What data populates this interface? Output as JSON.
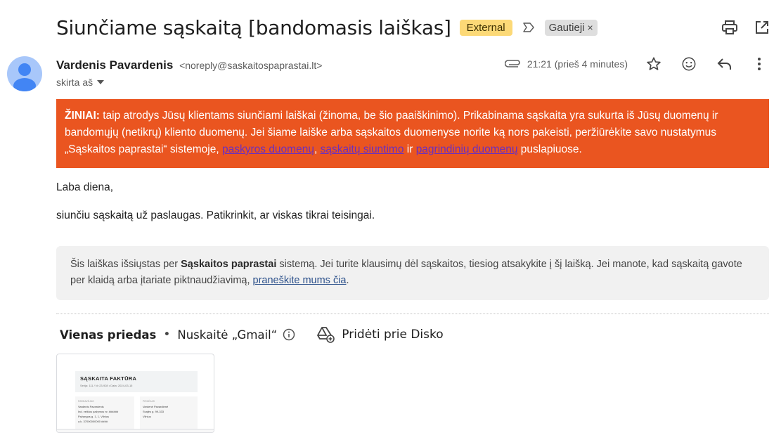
{
  "subject": "Siunčiame sąskaitą [bandomasis laiškas]",
  "badges": {
    "external": "External",
    "label": "Gautieji",
    "label_remove": "×"
  },
  "sender": {
    "name": "Vardenis Pavardenis",
    "email": "<noreply@saskaitospaprastai.lt>",
    "to": "skirta aš",
    "time": "21:21 (prieš 4 minutes)"
  },
  "notice": {
    "lead": "ŽINIAI:",
    "text1": " taip atrodys Jūsų klientams siunčiami laiškai (žinoma, be šio paaiškinimo). Prikabinama sąskaita yra sukurta iš Jūsų duomenų ir bandomųjų (netikrų) kliento duomenų. Jei šiame laiške arba sąskaitos duomenyse norite ką nors pakeisti, peržiūrėkite savo nustatymus „Sąskaitos paprastai“ sistemoje, ",
    "link1": "paskyros duomenų",
    "sep1": ", ",
    "link2": "sąskaitų siuntimo",
    "sep2": " ir ",
    "link3": "pagrindinių duomenų",
    "text2": " puslapiuose."
  },
  "body": {
    "greeting": "Laba diena,",
    "line": "siunčiu sąskaitą už paslaugas. Patikrinkit, ar viskas tikrai teisingai."
  },
  "footer": {
    "text1": "Šis laiškas išsiųstas per ",
    "brand": "Sąskaitos paprastai",
    "text2": " sistemą. Jei turite klausimų dėl sąskaitos, tiesiog atsakykite į šį laišką. Jei manote, kad sąskaitą gavote per klaidą arba įtariate piktnaudžiavimą, ",
    "link": "praneškite mums čia",
    "text3": "."
  },
  "attachments": {
    "count": "Vienas priedas",
    "dot": "•",
    "scanned": "Nuskaitė „Gmail“",
    "drive": "Pridėti prie Disko"
  },
  "thumbnail": {
    "title": "SĄSKAITA FAKTŪRA",
    "sub": "Serija: 111 / Nr 23-928  •  Data: 2024-03-15",
    "seller_cap": "Pardavėjas",
    "seller": [
      "Vardenis Pavardenis",
      "Ind. veiklos pažymos nr. ######",
      "Pažangos g. 1, 1, Vilnius",
      "a.k. 37000000000 ####"
    ],
    "buyer_cap": "Pirkėjas",
    "buyer": [
      "Vardenė Pavardienė",
      "Svajės g. 99-333",
      "Vilnius"
    ]
  },
  "colors": {
    "notice_bg": "#ea5520",
    "external_badge": "#fcd977",
    "avatar": "#a8c7fa"
  }
}
